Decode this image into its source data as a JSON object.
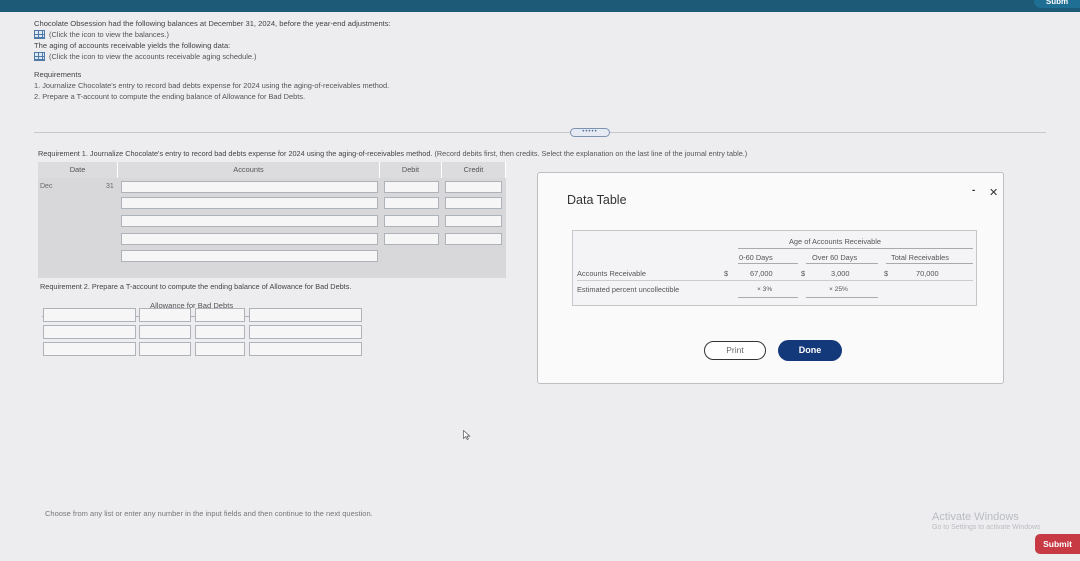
{
  "header": {
    "badge": "Subm"
  },
  "intro": {
    "line1": "Chocolate Obsession had the following balances at December 31, 2024, before the year-end adjustments:",
    "link1": "(Click the icon to view the balances.)",
    "line2": "The aging of accounts receivable yields the following data:",
    "link2": "(Click the icon to view the accounts receivable aging schedule.)"
  },
  "requirements": {
    "heading": "Requirements",
    "items": [
      "1.  Journalize Chocolate's entry to record bad debts expense for 2024 using the aging-of-receivables method.",
      "2.  Prepare a T-account to compute the ending balance of Allowance for Bad Debts."
    ]
  },
  "divider_handle": "•••••",
  "req1": {
    "text": "Requirement 1. Journalize Chocolate's entry to record bad debts expense for 2024 using the aging-of-receivables method.",
    "note": "(Record debits first, then credits. Select the explanation on the last line of the journal entry table.)"
  },
  "journal": {
    "headers": {
      "date": "Date",
      "accounts": "Accounts",
      "debit": "Debit",
      "credit": "Credit"
    },
    "month": "Dec",
    "day": "31"
  },
  "req2": {
    "text": "Requirement 2. Prepare a T-account to compute the ending balance of Allowance for Bad Debts.",
    "taccount_title": "Allowance for Bad Debts"
  },
  "footer": {
    "instruction": "Choose from any list or enter any number in the input fields and then continue to the next question."
  },
  "modal": {
    "title": "Data Table",
    "minimize": "-",
    "close": "✕",
    "table": {
      "group_header": "Age of Accounts Receivable",
      "columns": [
        "0-60 Days",
        "Over 60 Days",
        "Total Receivables"
      ],
      "rows": [
        {
          "label": "Accounts Receivable",
          "cur1": "$",
          "v1": "67,000",
          "cur2": "$",
          "v2": "3,000",
          "cur3": "$",
          "v3": "70,000"
        },
        {
          "label": "Estimated percent uncollectible",
          "v1": "× 3%",
          "v2": "× 25%"
        }
      ]
    },
    "print_label": "Print",
    "done_label": "Done"
  },
  "watermark": {
    "line1": "Activate Windows",
    "line2": "Go to Settings to activate Windows"
  },
  "submit_label": "Submit"
}
